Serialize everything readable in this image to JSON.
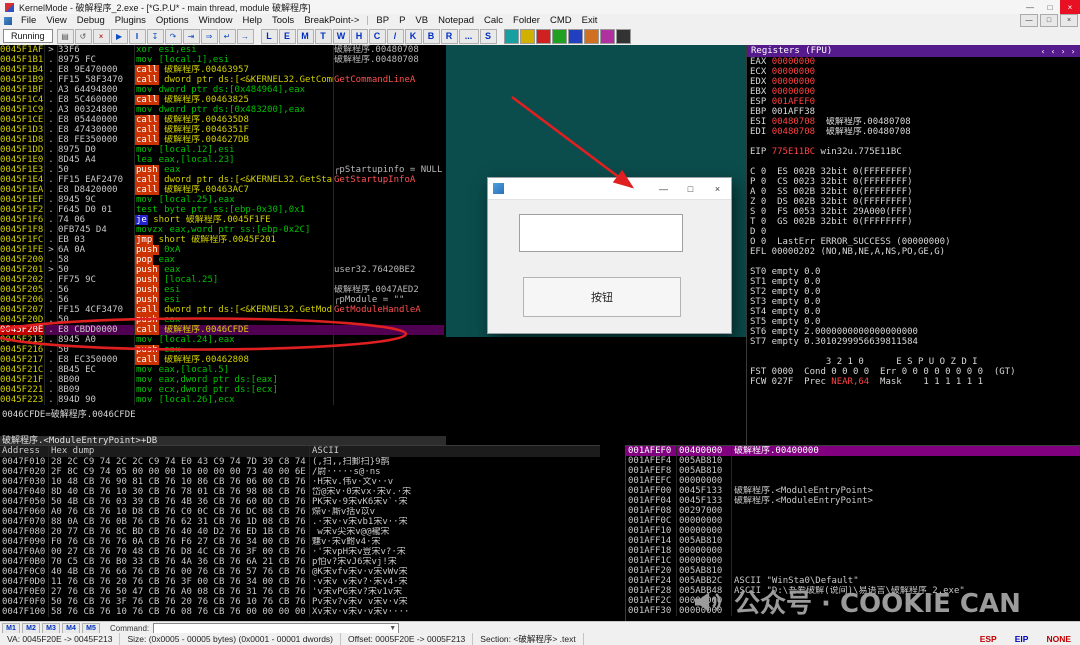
{
  "title_bar": {
    "title": "KernelMode - 破解程序_2.exe - [*G.P.U* - main thread, module 破解程序]",
    "buttons": [
      {
        "id": "minimize",
        "glyph": "—"
      },
      {
        "id": "maximize",
        "glyph": "□"
      },
      {
        "id": "close",
        "glyph": "×"
      }
    ]
  },
  "menu": {
    "items": [
      {
        "id": "file",
        "label": "File"
      },
      {
        "id": "view",
        "label": "View"
      },
      {
        "id": "debug",
        "label": "Debug"
      },
      {
        "id": "plugins",
        "label": "Plugins"
      },
      {
        "id": "options",
        "label": "Options"
      },
      {
        "id": "window",
        "label": "Window"
      },
      {
        "id": "help",
        "label": "Help"
      },
      {
        "id": "tools",
        "label": "Tools"
      },
      {
        "id": "breakpoint",
        "label": "BreakPoint->"
      }
    ],
    "plugin_items": [
      {
        "id": "bp",
        "label": "BP"
      },
      {
        "id": "p",
        "label": "P"
      },
      {
        "id": "vb",
        "label": "VB"
      },
      {
        "id": "notepad",
        "label": "Notepad"
      },
      {
        "id": "calc",
        "label": "Calc"
      },
      {
        "id": "folder",
        "label": "Folder"
      },
      {
        "id": "cmd",
        "label": "CMD"
      },
      {
        "id": "exit",
        "label": "Exit"
      }
    ],
    "mdi_buttons": [
      {
        "id": "minimize",
        "glyph": "—"
      },
      {
        "id": "restore",
        "glyph": "□"
      },
      {
        "id": "close",
        "glyph": "×"
      }
    ]
  },
  "toolbar": {
    "status": "Running",
    "icon_buttons": [
      {
        "name": "open-file-icon",
        "glyph": "▤",
        "color": "#555555"
      },
      {
        "name": "restart-icon",
        "glyph": "↺",
        "color": "#555555"
      },
      {
        "name": "close-program-icon",
        "glyph": "×",
        "color": "#a00000"
      },
      {
        "name": "run-icon",
        "glyph": "▶",
        "color": "#104fc0"
      },
      {
        "name": "pause-icon",
        "glyph": "‖",
        "color": "#104fc0"
      },
      {
        "name": "step-into-icon",
        "glyph": "↧",
        "color": "#104fc0"
      },
      {
        "name": "step-over-icon",
        "glyph": "↷",
        "color": "#104fc0"
      },
      {
        "name": "trace-into-icon",
        "glyph": "⇥",
        "color": "#104fc0"
      },
      {
        "name": "trace-over-icon",
        "glyph": "⇒",
        "color": "#104fc0"
      },
      {
        "name": "execute-till-return-icon",
        "glyph": "↵",
        "color": "#104fc0"
      },
      {
        "name": "go-to-address-icon",
        "glyph": "→",
        "color": "#104fc0"
      }
    ],
    "letter_buttons": [
      "L",
      "E",
      "M",
      "T",
      "W",
      "H",
      "C",
      "/",
      "K",
      "B",
      "R",
      "...",
      "S"
    ],
    "plugin_chips": [
      {
        "name": "plugin-icon-teal",
        "color": "#18a0a0"
      },
      {
        "name": "plugin-icon-yellow",
        "color": "#d0b000"
      },
      {
        "name": "plugin-icon-red",
        "color": "#d02020"
      },
      {
        "name": "plugin-icon-green",
        "color": "#20a020"
      },
      {
        "name": "plugin-icon-blue",
        "color": "#2040c0"
      },
      {
        "name": "plugin-icon-orange",
        "color": "#d07020"
      },
      {
        "name": "plugin-icon-magenta",
        "color": "#b030a0"
      },
      {
        "name": "plugin-icon-dark",
        "color": "#333333"
      }
    ]
  },
  "disasm": {
    "info1": "0046CFDE=破解程序.0046CFDE",
    "info2": "破解程序.<ModuleEntryPoint>+DB",
    "rows": [
      {
        "a": "0045F1AF",
        "f": ">",
        "b": "33F6",
        "m": "xor",
        "o": "esi,esi",
        "s": "plain",
        "c": "破解程序.00480708",
        "cc": "gray"
      },
      {
        "a": "0045F1B1",
        "f": ".",
        "b": "8975 FC",
        "m": "mov",
        "o": "[local.1],esi",
        "s": "plain",
        "c": "破解程序.00480708",
        "cc": "gray"
      },
      {
        "a": "0045F1B4",
        "f": ".",
        "b": "E8 9E470000",
        "m": "call",
        "o": "破解程序.00463957",
        "s": "call",
        "c": ""
      },
      {
        "a": "0045F1B9",
        "f": ".",
        "b": "FF15 58F3470",
        "m": "call",
        "o": "dword ptr ds:[<&KERNEL32.GetComman",
        "s": "call",
        "c": "GetCommandLineA",
        "cc": "red"
      },
      {
        "a": "0045F1BF",
        "f": ".",
        "b": "A3 64494800",
        "m": "mov",
        "o": "dword ptr ds:[0x484964],eax",
        "s": "plain",
        "c": ""
      },
      {
        "a": "0045F1C4",
        "f": ".",
        "b": "E8 5C460000",
        "m": "call",
        "o": "破解程序.00463825",
        "s": "call",
        "c": ""
      },
      {
        "a": "0045F1C9",
        "f": ".",
        "b": "A3 00324800",
        "m": "mov",
        "o": "dword ptr ds:[0x483200],eax",
        "s": "plain",
        "c": ""
      },
      {
        "a": "0045F1CE",
        "f": ".",
        "b": "E8 05440000",
        "m": "call",
        "o": "破解程序.004635D8",
        "s": "call",
        "c": ""
      },
      {
        "a": "0045F1D3",
        "f": ".",
        "b": "E8 47430000",
        "m": "call",
        "o": "破解程序.0046351F",
        "s": "call",
        "c": ""
      },
      {
        "a": "0045F1D8",
        "f": ".",
        "b": "E8 FE350000",
        "m": "call",
        "o": "破解程序.004627DB",
        "s": "call",
        "c": ""
      },
      {
        "a": "0045F1DD",
        "f": ".",
        "b": "8975 D0",
        "m": "mov",
        "o": "[local.12],esi",
        "s": "plain",
        "c": ""
      },
      {
        "a": "0045F1E0",
        "f": ".",
        "b": "8D45 A4",
        "m": "lea",
        "o": "eax,[local.23]",
        "s": "plain",
        "c": ""
      },
      {
        "a": "0045F1E3",
        "f": ".",
        "b": "50",
        "m": "push",
        "o": "eax",
        "s": "push",
        "c": "┌pStartupinfo = NULL",
        "cc": "gray"
      },
      {
        "a": "0045F1E4",
        "f": ".",
        "b": "FF15 EAF2470",
        "m": "call",
        "o": "dword ptr ds:[<&KERNEL32.GetStartu",
        "s": "call",
        "c": "GetStartupInfoA",
        "cc": "red"
      },
      {
        "a": "0045F1EA",
        "f": ".",
        "b": "E8 D8420000",
        "m": "call",
        "o": "破解程序.00463AC7",
        "s": "call",
        "c": ""
      },
      {
        "a": "0045F1EF",
        "f": ".",
        "b": "8945 9C",
        "m": "mov",
        "o": "[local.25],eax",
        "s": "plain",
        "c": ""
      },
      {
        "a": "0045F1F2",
        "f": ".",
        "b": "F645 D0 01",
        "m": "test",
        "o": "byte ptr ss:[ebp-0x30],0x1",
        "s": "plain",
        "c": ""
      },
      {
        "a": "0045F1F6",
        "f": ".",
        "b": "74 06",
        "m": "je",
        "o": "short 破解程序.0045F1FE",
        "s": "jcc",
        "c": ""
      },
      {
        "a": "0045F1F8",
        "f": ".",
        "b": "0FB745 D4",
        "m": "movzx",
        "o": "eax,word ptr ss:[ebp-0x2C]",
        "s": "plain",
        "c": ""
      },
      {
        "a": "0045F1FC",
        "f": ".",
        "b": "EB 03",
        "m": "jmp",
        "o": "short 破解程序.0045F201",
        "s": "jmp",
        "c": ""
      },
      {
        "a": "0045F1FE",
        "f": ">",
        "b": "6A 0A",
        "m": "push",
        "o": "0xA",
        "s": "push",
        "c": ""
      },
      {
        "a": "0045F200",
        "f": ".",
        "b": "58",
        "m": "pop",
        "o": "eax",
        "s": "push",
        "c": ""
      },
      {
        "a": "0045F201",
        "f": ">",
        "b": "50",
        "m": "push",
        "o": "eax",
        "s": "push",
        "c": "user32.76420BE2",
        "cc": "gray"
      },
      {
        "a": "0045F202",
        "f": ".",
        "b": "FF75 9C",
        "m": "push",
        "o": "[local.25]",
        "s": "push",
        "c": ""
      },
      {
        "a": "0045F205",
        "f": ".",
        "b": "56",
        "m": "push",
        "o": "esi",
        "s": "push",
        "c": "破解程序.0047AED2",
        "cc": "gray"
      },
      {
        "a": "0045F206",
        "f": ".",
        "b": "56",
        "m": "push",
        "o": "esi",
        "s": "push",
        "c": "┌pModule = \"\"",
        "cc": "gray"
      },
      {
        "a": "0045F207",
        "f": ".",
        "b": "FF15 4CF3470",
        "m": "call",
        "o": "dword ptr ds:[<&KERNEL32.GetModule",
        "s": "call",
        "c": "GetModuleHandleA",
        "cc": "red"
      },
      {
        "a": "0045F20D",
        "f": ".",
        "b": "50",
        "m": "push",
        "o": "eax",
        "s": "push",
        "c": ""
      },
      {
        "a": "0045F20E",
        "f": ".",
        "b": "E8 CBDD0000",
        "m": "call",
        "o": "破解程序.0046CFDE",
        "s": "call",
        "c": "",
        "sel": true
      },
      {
        "a": "0045F213",
        "f": ".",
        "b": "8945 A0",
        "m": "mov",
        "o": "[local.24],eax",
        "s": "plain",
        "c": ""
      },
      {
        "a": "0045F216",
        "f": ".",
        "b": "50",
        "m": "push",
        "o": "eax",
        "s": "push",
        "c": ""
      },
      {
        "a": "0045F217",
        "f": ".",
        "b": "E8 EC350000",
        "m": "call",
        "o": "破解程序.00462808",
        "s": "call",
        "c": ""
      },
      {
        "a": "0045F21C",
        "f": ".",
        "b": "8B45 EC",
        "m": "mov",
        "o": "eax,[local.5]",
        "s": "plain",
        "c": ""
      },
      {
        "a": "0045F21F",
        "f": ".",
        "b": "8B00",
        "m": "mov",
        "o": "eax,dword ptr ds:[eax]",
        "s": "plain",
        "c": ""
      },
      {
        "a": "0045F221",
        "f": ".",
        "b": "8B09",
        "m": "mov",
        "o": "ecx,dword ptr ds:[ecx]",
        "s": "plain",
        "c": ""
      },
      {
        "a": "0045F223",
        "f": ".",
        "b": "894D 90",
        "m": "mov",
        "o": "[local.26],ecx",
        "s": "plain",
        "c": ""
      }
    ]
  },
  "registers": {
    "header": "Registers (FPU)",
    "scroll_arrows": [
      "‹",
      "‹",
      "›",
      "›"
    ],
    "gpr": [
      {
        "name": "EAX",
        "value": "00000000",
        "changed": true,
        "comment": ""
      },
      {
        "name": "ECX",
        "value": "00000000",
        "changed": true,
        "comment": ""
      },
      {
        "name": "EDX",
        "value": "00000000",
        "changed": true,
        "comment": ""
      },
      {
        "name": "EBX",
        "value": "00000000",
        "changed": true,
        "comment": ""
      },
      {
        "name": "ESP",
        "value": "001AFEF0",
        "changed": true,
        "comment": ""
      },
      {
        "name": "EBP",
        "value": "001AFF38",
        "changed": false,
        "comment": ""
      },
      {
        "name": "ESI",
        "value": "00480708",
        "changed": true,
        "comment": "破解程序.00480708"
      },
      {
        "name": "EDI",
        "value": "00480708",
        "changed": true,
        "comment": "破解程序.00480708"
      }
    ],
    "eip": {
      "name": "EIP",
      "value": "775E11BC",
      "comment": "win32u.775E11BC"
    },
    "flag_lines": [
      "C 0  ES 002B 32bit 0(FFFFFFFF)",
      "P 0  CS 0023 32bit 0(FFFFFFFF)",
      "A 0  SS 002B 32bit 0(FFFFFFFF)",
      "Z 0  DS 002B 32bit 0(FFFFFFFF)",
      "S 0  FS 0053 32bit 29A000(FFF)",
      "T 0  GS 002B 32bit 0(FFFFFFFF)",
      "D 0",
      "O 0  LastErr ERROR_SUCCESS (00000000)"
    ],
    "efl": "EFL 00000202 (NO,NB,NE,A,NS,PO,GE,G)",
    "st": [
      "ST0 empty 0.0",
      "ST1 empty 0.0",
      "ST2 empty 0.0",
      "ST3 empty 0.0",
      "ST4 empty 0.0",
      "ST5 empty 0.0",
      "ST6 empty 2.0000000000000000000",
      "ST7 empty 0.3010299956639811584"
    ],
    "st_cols": "              3 2 1 0      E S P U O Z D I",
    "fst": "FST 0000  Cond 0 0 0 0  Err 0 0 0 0 0 0 0 0  (GT)",
    "fcw_pre": "FCW 027F  Prec ",
    "fcw_red": "NEAR,64",
    "fcw_post": "  Mask    1 1 1 1 1 1"
  },
  "dump": {
    "headers": [
      "Address",
      "Hex dump",
      "ASCII"
    ],
    "rows": [
      {
        "addr": "0047F010",
        "hex": "28 2C C9 74 2C 2C C9 74 E0 43 C9 74 7D 39 C8 74",
        "ascii": "(,扫,,扫郵扫}9鹊"
      },
      {
        "addr": "0047F020",
        "hex": "2F 8C C9 74 05 00 00 00 10 00 00 00 73 40 00 6E",
        "ascii": "/尉·····s@·ns"
      },
      {
        "addr": "0047F030",
        "hex": "10 48 CB 76 90 81 CB 76 10 86 CB 76 06 00 CB 76",
        "ascii": "·H宋v.伟v·文v··v"
      },
      {
        "addr": "0047F040",
        "hex": "8D 40 CB 76 10 30 CB 76 78 01 CB 76 98 08 CB 76",
        "ascii": "岱@宋v·0宋vx·宋v.·宋"
      },
      {
        "addr": "0047F050",
        "hex": "50 4B CB 76 03 39 CB 76 4B 36 CB 76 60 0D CB 76",
        "ascii": "PK宋v·9宋vK6宋v`·宋"
      },
      {
        "addr": "0047F060",
        "hex": "A0 76 CB 76 10 D8 CB 76 C0 0C CB 76 DC 08 CB 76",
        "ascii": "爃v·厮v括v苡v"
      },
      {
        "addr": "0047F070",
        "hex": "88 0A CB 76 0B 76 CB 76 62 31 CB 76 1D 08 CB 76",
        "ascii": ".·宋v·v宋vb1宋v··宋"
      },
      {
        "addr": "0047F080",
        "hex": "20 77 CB 76 8C BD CB 76 40 40 D2 76 ED 1B CB 76",
        "ascii": " w宋v尖宋v@@襱宋"
      },
      {
        "addr": "0047F090",
        "hex": "F0 76 CB 76 76 0A CB 76 F6 27 CB 76 34 00 CB 76",
        "ascii": "魐v·宋v鲋v4·宋"
      },
      {
        "addr": "0047F0A0",
        "hex": "00 27 CB 76 70 48 CB 76 D8 4C CB 76 3F 00 CB 76",
        "ascii": "·'宋vpH宋v豈宋v?·宋"
      },
      {
        "addr": "0047F0B0",
        "hex": "70 C5 CB 76 B0 33 CB 76 4A 36 CB 76 6A 21 CB 76",
        "ascii": "p怕v?宋vJ6宋vj!宋"
      },
      {
        "addr": "0047F0C0",
        "hex": "40 4B CB 76 66 76 CB 76 00 76 CB 76 57 76 CB 76",
        "ascii": "@K宋vfv宋v·v宋vWv宋"
      },
      {
        "addr": "0047F0D0",
        "hex": "11 76 CB 76 20 76 CB 76 3F 00 CB 76 34 00 CB 76",
        "ascii": "·v宋v v宋v?·宋v4·宋"
      },
      {
        "addr": "0047F0E0",
        "hex": "27 76 CB 76 50 47 CB 76 A0 08 CB 76 31 76 CB 76",
        "ascii": "'v宋vPG宋v?宋v1v宋"
      },
      {
        "addr": "0047F0F0",
        "hex": "50 76 CB 76 3F 76 CB 76 20 76 CB 76 10 76 CB 76",
        "ascii": "Pv宋v?v宋v v宋v·v宋"
      },
      {
        "addr": "0047F100",
        "hex": "58 76 CB 76 10 76 CB 76 08 76 CB 76 00 00 00 00",
        "ascii": "Xv宋v·v宋v·v宋v····"
      }
    ]
  },
  "stack": {
    "rows": [
      {
        "addr": "001AFEF0",
        "value": "00400000",
        "comment": "破解程序.00400000",
        "hl": true
      },
      {
        "addr": "001AFEF4",
        "value": "005AB810",
        "comment": ""
      },
      {
        "addr": "001AFEF8",
        "value": "005AB810",
        "comment": ""
      },
      {
        "addr": "001AFEFC",
        "value": "00000000",
        "comment": ""
      },
      {
        "addr": "001AFF00",
        "value": "0045F133",
        "comment": "破解程序.<ModuleEntryPoint>"
      },
      {
        "addr": "001AFF04",
        "value": "0045F133",
        "comment": "破解程序.<ModuleEntryPoint>"
      },
      {
        "addr": "001AFF08",
        "value": "00297000",
        "comment": ""
      },
      {
        "addr": "001AFF0C",
        "value": "00000000",
        "comment": ""
      },
      {
        "addr": "001AFF10",
        "value": "00000000",
        "comment": ""
      },
      {
        "addr": "001AFF14",
        "value": "005AB810",
        "comment": ""
      },
      {
        "addr": "001AFF18",
        "value": "00000000",
        "comment": ""
      },
      {
        "addr": "001AFF1C",
        "value": "00000000",
        "comment": ""
      },
      {
        "addr": "001AFF20",
        "value": "005AB810",
        "comment": ""
      },
      {
        "addr": "001AFF24",
        "value": "005ABB2C",
        "comment": "ASCII \"WinSta0\\Default\""
      },
      {
        "addr": "001AFF28",
        "value": "005ABB48",
        "comment": "ASCII \"D:\\吾爱破解(说间)\\易语言\\破解程序_2.exe\""
      },
      {
        "addr": "001AFF2C",
        "value": "00000000",
        "comment": ""
      },
      {
        "addr": "001AFF30",
        "value": "00000000",
        "comment": ""
      }
    ]
  },
  "dialog": {
    "edit_value": "",
    "button_label": "按钮",
    "buttons": [
      {
        "id": "minimize",
        "glyph": "—"
      },
      {
        "id": "maximize",
        "glyph": "□"
      },
      {
        "id": "close",
        "glyph": "×"
      }
    ]
  },
  "command_bar": {
    "m_buttons": [
      "M1",
      "M2",
      "M3",
      "M4",
      "M5"
    ],
    "command_label": "Command:",
    "dropdown_glyph": "▼"
  },
  "status_bar": {
    "va": "VA: 0045F20E -> 0045F213",
    "size": "Size: (0x0005 - 00005 bytes)  (0x0001 - 00001 dwords)",
    "offset": "Offset: 0005F20E -> 0005F213",
    "section": "Section: <破解程序> .text",
    "indicators": [
      {
        "label": "ESP",
        "color": "#c00000"
      },
      {
        "label": "EIP",
        "color": "#0000c0"
      },
      {
        "label": "NONE",
        "color": "#c00000"
      }
    ]
  },
  "watermark": {
    "text": "公众号 · COOKIE CAN"
  },
  "colors": {
    "mdi_background_teal": "#0b4c4c",
    "pane_header_purple": "#551a8b",
    "stack_highlight_purple": "#800080",
    "selected_row_purple": "#500050",
    "breakpoint_red": "#c00000",
    "annotation_red": "#e02020"
  }
}
